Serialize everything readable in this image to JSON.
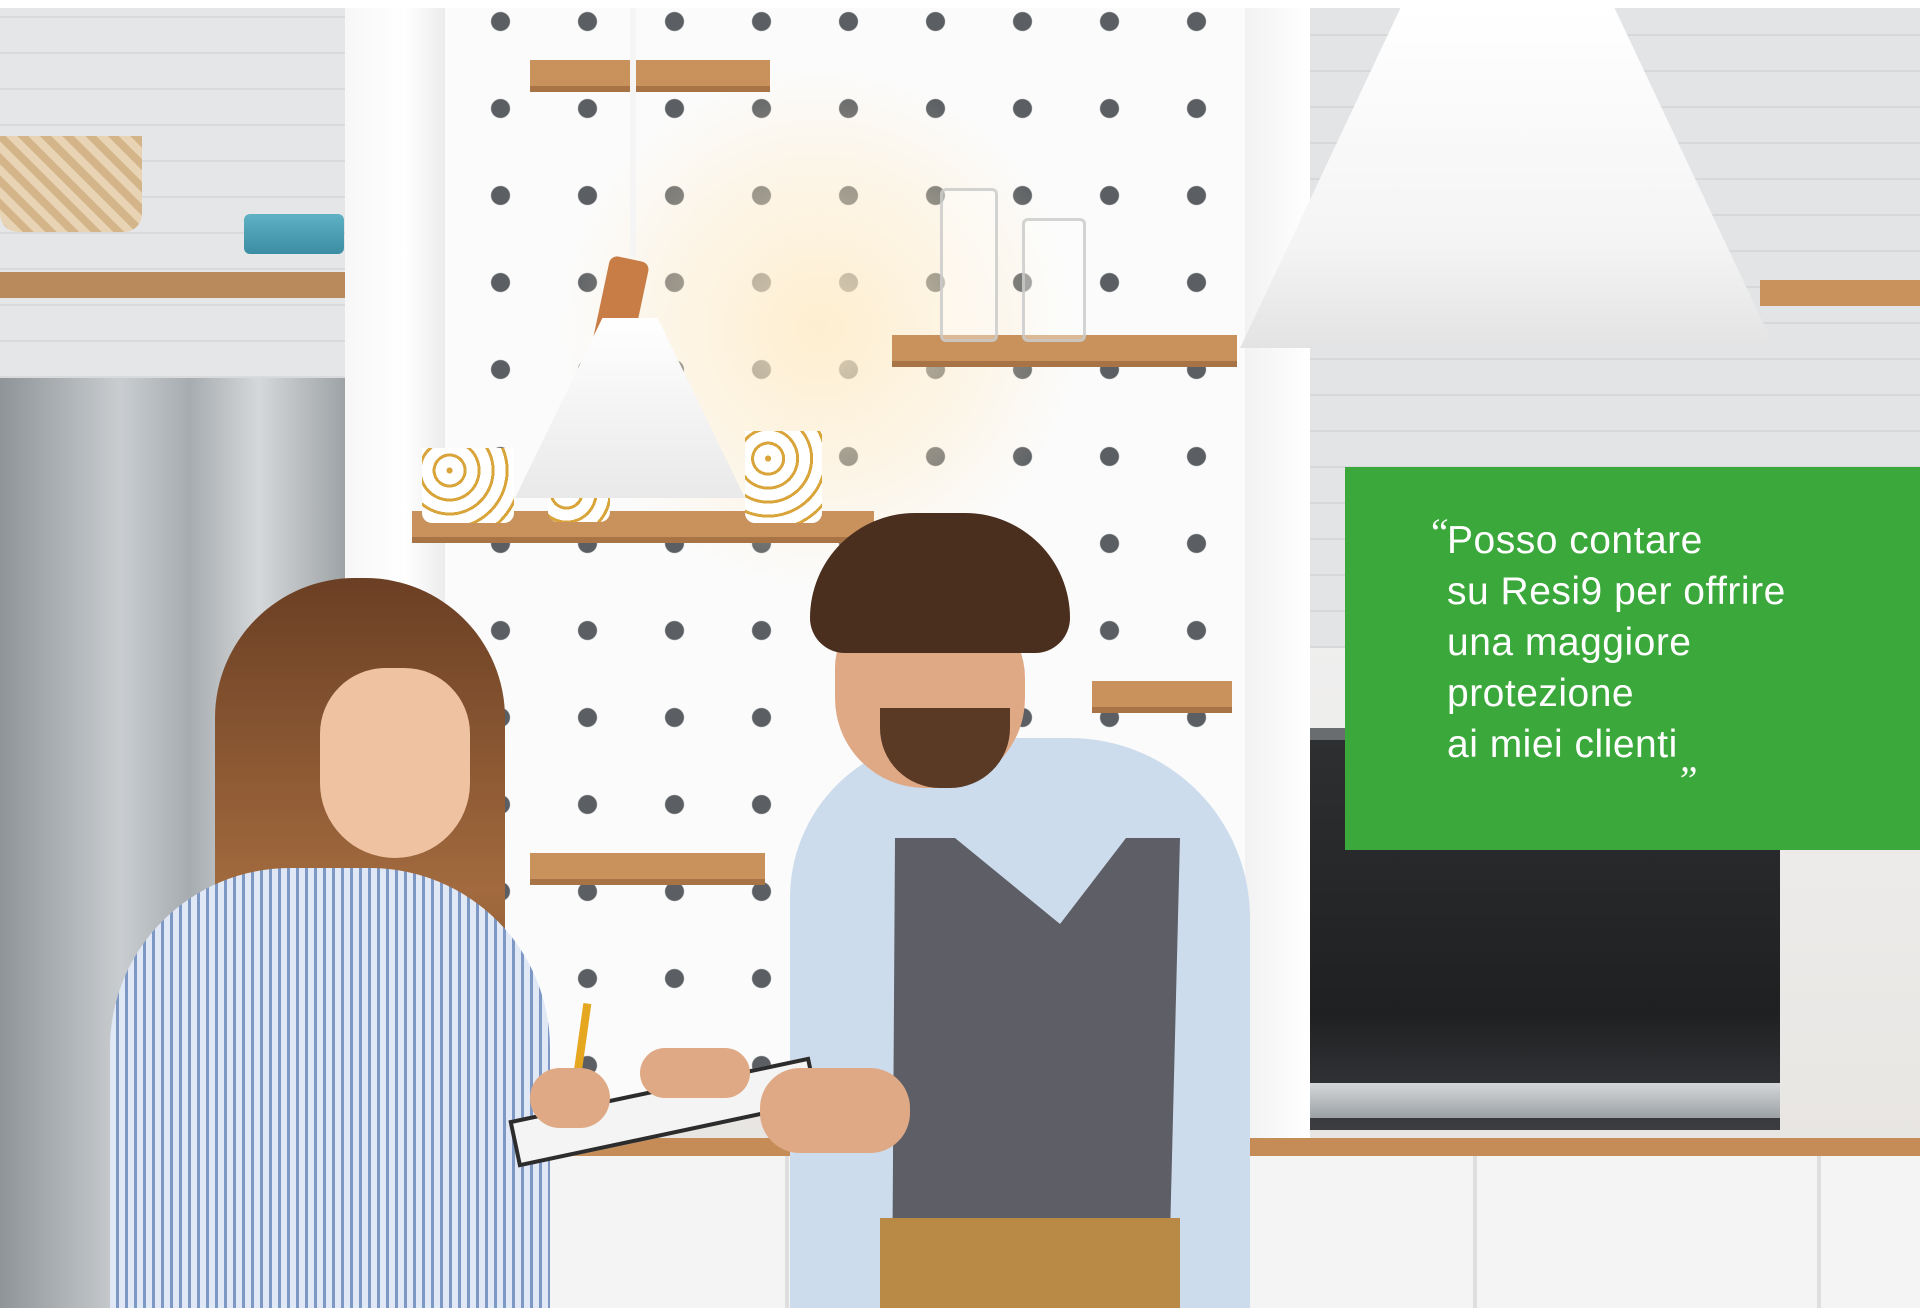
{
  "quote": {
    "open_mark": "“",
    "lines": [
      "Posso contare",
      "su Resi9 per offrire",
      "una maggiore",
      "protezione",
      "ai miei clienti"
    ],
    "close_mark": "„",
    "background_color": "#3aa83a",
    "text_color": "#ffffff"
  }
}
